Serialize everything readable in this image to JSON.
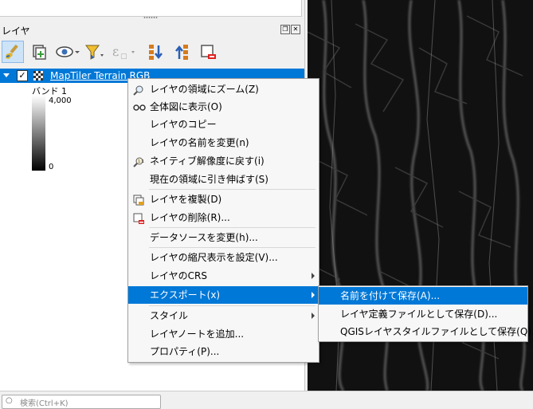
{
  "panel": {
    "title": "レイヤ",
    "float_icon": "float-icon",
    "close_icon": "close-icon"
  },
  "toolbar": {
    "items": [
      "style-brush-icon",
      "add-group-icon",
      "visibility-eye-icon",
      "filter-icon",
      "expression-filter-icon",
      "expand-all-icon",
      "collapse-all-icon",
      "remove-layer-icon"
    ]
  },
  "layer": {
    "name": "MapTiler Terrain RGB",
    "checked": true,
    "band_label": "バンド 1",
    "max_value": "4,000",
    "min_value": "0"
  },
  "context_menu": {
    "items": [
      {
        "label": "レイヤの領域にズーム(Z)",
        "icon": "zoom-icon"
      },
      {
        "label": "全体図に表示(O)",
        "icon": "overview-icon"
      },
      {
        "label": "レイヤのコピー"
      },
      {
        "label": "レイヤの名前を変更(n)"
      },
      {
        "label": "ネイティブ解像度に戻す(i)",
        "icon": "native-resolution-icon"
      },
      {
        "label": "現在の領域に引き伸ばす(S)"
      },
      {
        "label": "レイヤを複製(D)",
        "icon": "duplicate-icon"
      },
      {
        "label": "レイヤの削除(R)...",
        "icon": "remove-icon"
      },
      {
        "label": "データソースを変更(h)..."
      },
      {
        "label": "レイヤの縮尺表示を設定(V)..."
      },
      {
        "label": "レイヤのCRS"
      },
      {
        "label": "エクスポート(x)"
      },
      {
        "label": "スタイル"
      },
      {
        "label": "レイヤノートを追加..."
      },
      {
        "label": "プロパティ(P)..."
      }
    ]
  },
  "export_submenu": {
    "items": [
      {
        "label": "名前を付けて保存(A)..."
      },
      {
        "label": "レイヤ定義ファイルとして保存(D)..."
      },
      {
        "label": "QGISレイヤスタイルファイルとして保存(Q)..."
      }
    ]
  },
  "search": {
    "placeholder": "検索(Ctrl+K)"
  },
  "colors": {
    "highlight": "#0078d7",
    "map_background": "#0c0c0c"
  }
}
